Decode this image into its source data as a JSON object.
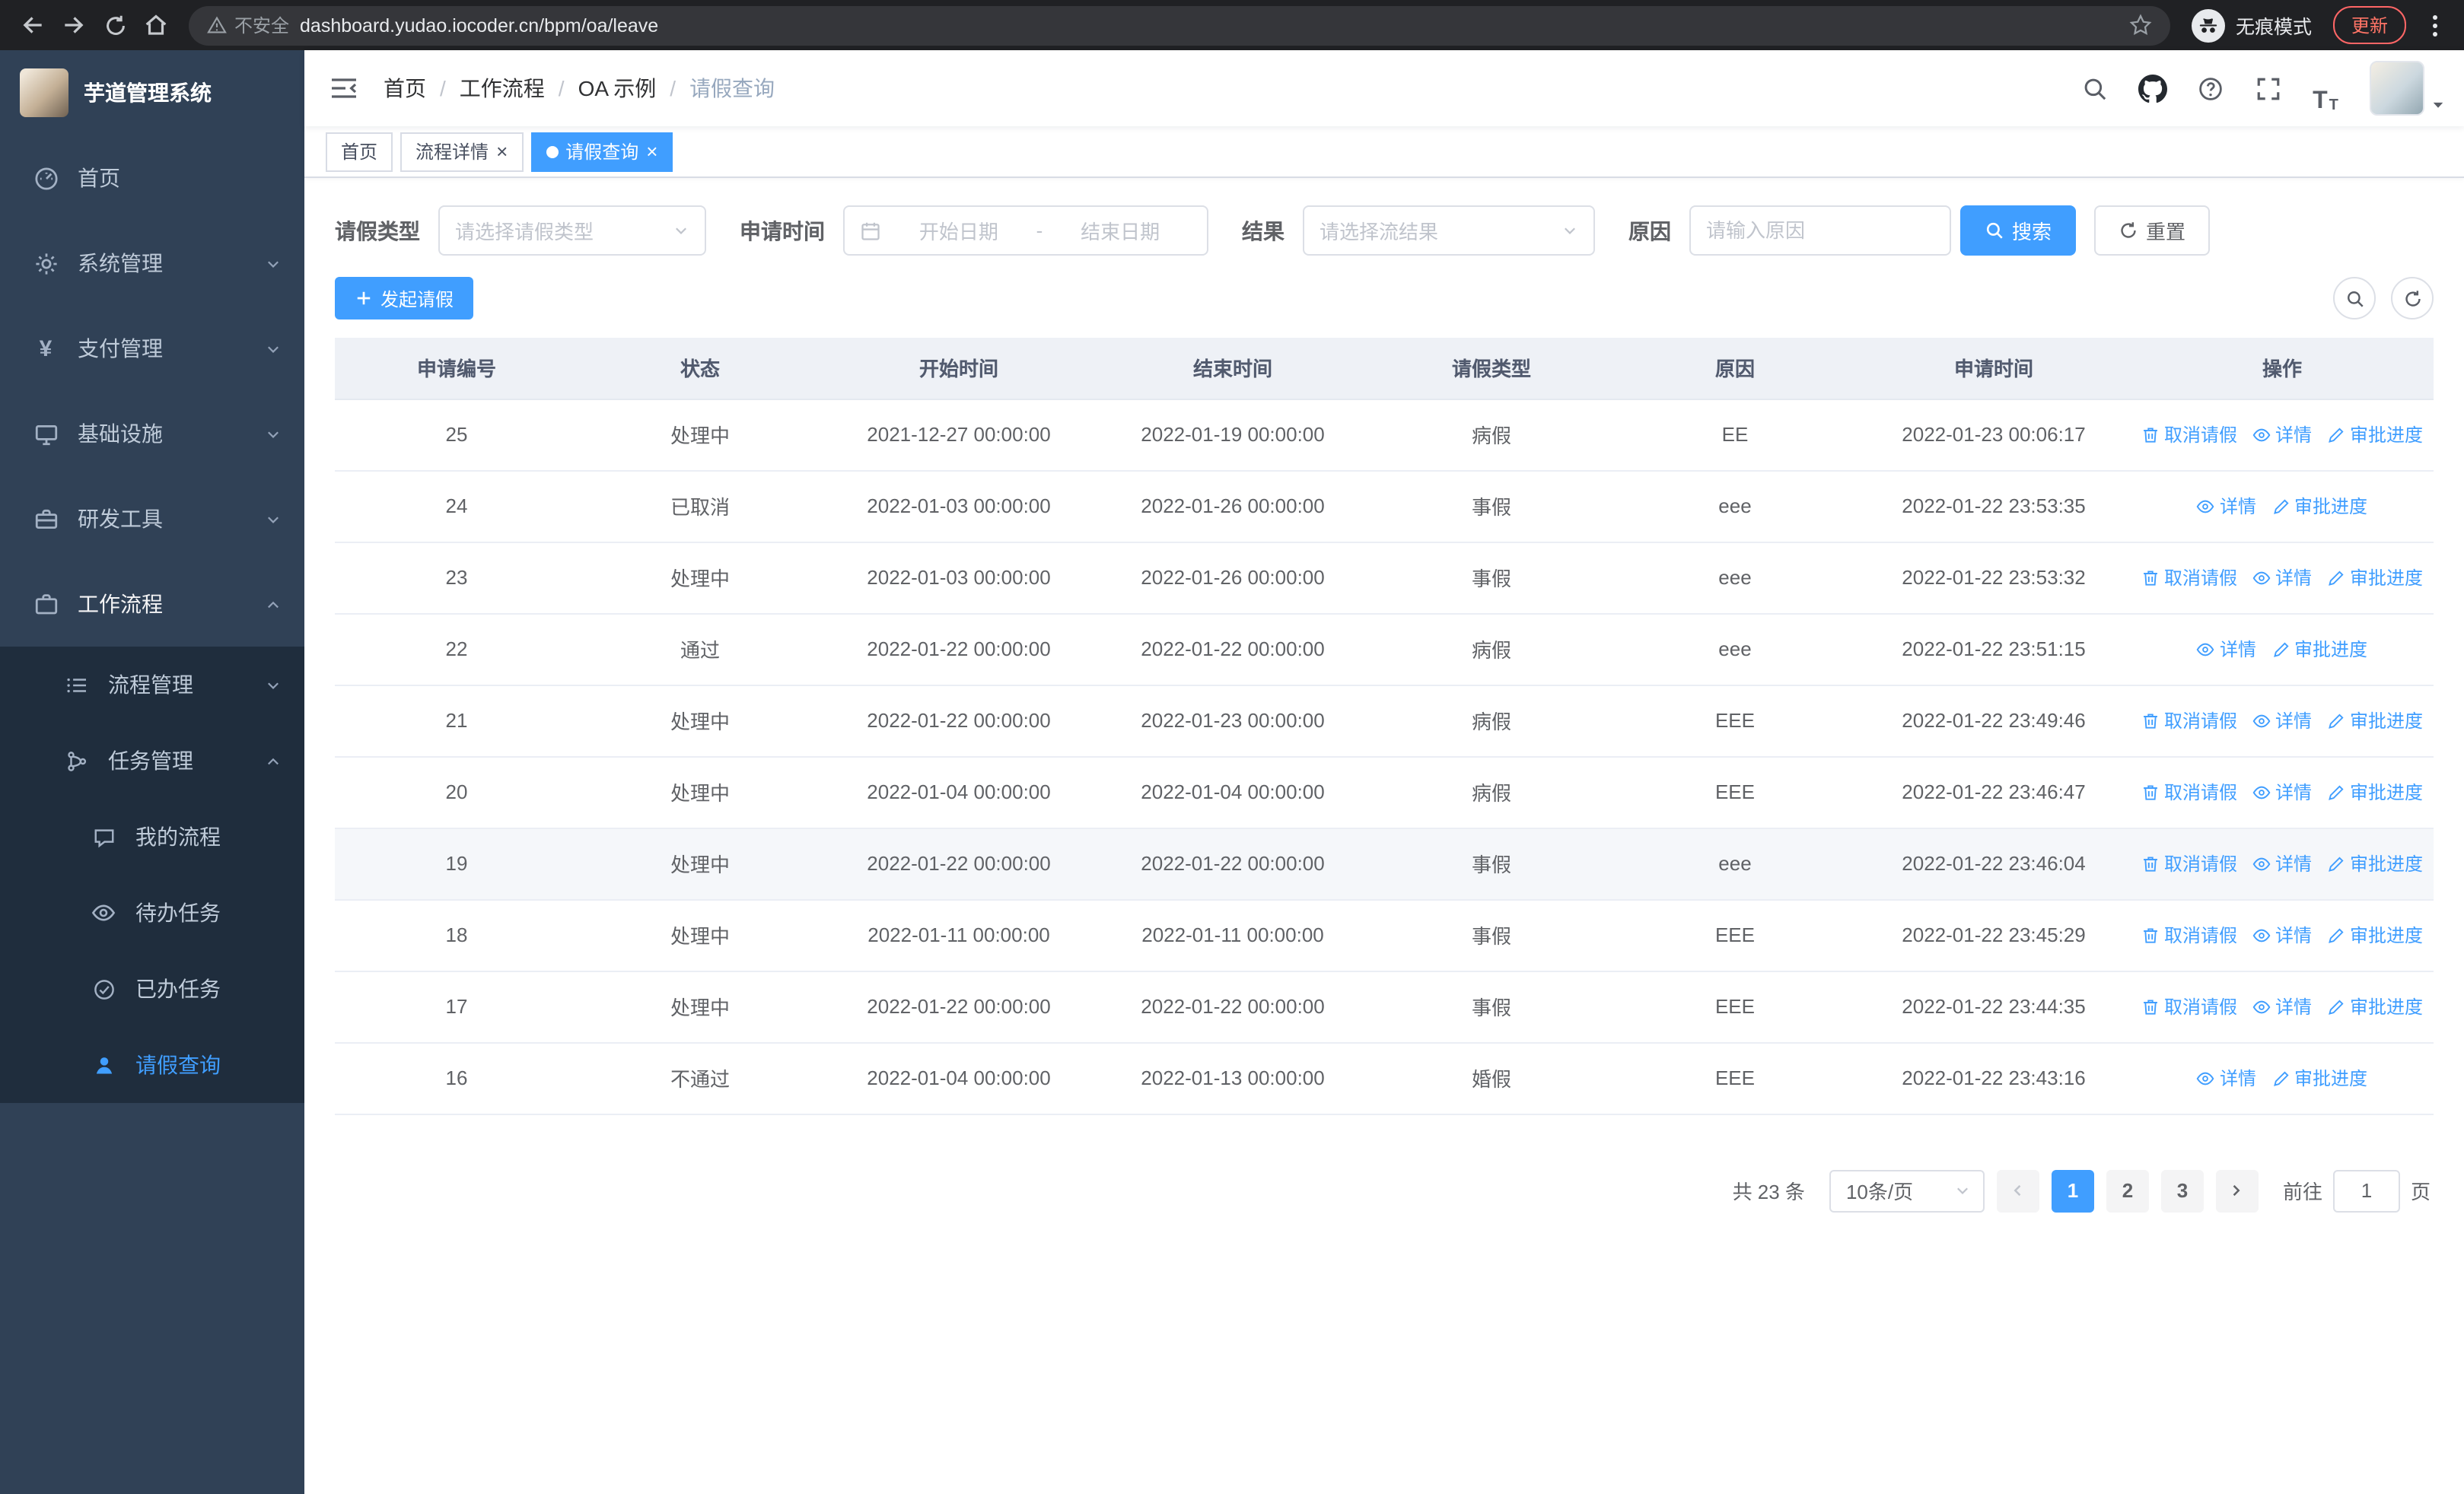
{
  "browser": {
    "security_label": "不安全",
    "url": "dashboard.yudao.iocoder.cn/bpm/oa/leave",
    "incognito_label": "无痕模式",
    "update_label": "更新"
  },
  "sidebar": {
    "app_title": "芋道管理系统",
    "items": [
      {
        "label": "首页"
      },
      {
        "label": "系统管理"
      },
      {
        "label": "支付管理"
      },
      {
        "label": "基础设施"
      },
      {
        "label": "研发工具"
      },
      {
        "label": "工作流程"
      }
    ],
    "workflow_children": [
      {
        "label": "流程管理"
      },
      {
        "label": "任务管理"
      }
    ],
    "task_children": [
      {
        "label": "我的流程"
      },
      {
        "label": "待办任务"
      },
      {
        "label": "已办任务"
      },
      {
        "label": "请假查询"
      }
    ]
  },
  "header": {
    "breadcrumb": [
      "首页",
      "工作流程",
      "OA 示例",
      "请假查询"
    ],
    "breadcrumb_separator": "/"
  },
  "tabs": {
    "close_glyph": "×",
    "items": [
      {
        "label": "首页"
      },
      {
        "label": "流程详情"
      },
      {
        "label": "请假查询"
      }
    ]
  },
  "filters": {
    "leave_type_label": "请假类型",
    "leave_type_placeholder": "请选择请假类型",
    "apply_time_label": "申请时间",
    "start_date_placeholder": "开始日期",
    "range_separator": "-",
    "end_date_placeholder": "结束日期",
    "result_label": "结果",
    "result_placeholder": "请选择流结果",
    "reason_label": "原因",
    "reason_placeholder": "请输入原因",
    "search_label": "搜索",
    "reset_label": "重置"
  },
  "toolbar": {
    "create_label": "发起请假"
  },
  "table": {
    "columns": [
      "申请编号",
      "状态",
      "开始时间",
      "结束时间",
      "请假类型",
      "原因",
      "申请时间",
      "操作"
    ],
    "action_labels": {
      "cancel": "取消请假",
      "detail": "详情",
      "progress": "审批进度"
    },
    "action_icons": {
      "cancel": "delete-icon",
      "detail": "eye-icon",
      "progress": "edit-icon"
    },
    "rows": [
      {
        "apply_no": "25",
        "status": "处理中",
        "start_time": "2021-12-27 00:00:00",
        "end_time": "2022-01-19 00:00:00",
        "leave_type": "病假",
        "reason": "EE",
        "apply_time": "2022-01-23 00:06:17",
        "cancelable": true,
        "highlighted": false
      },
      {
        "apply_no": "24",
        "status": "已取消",
        "start_time": "2022-01-03 00:00:00",
        "end_time": "2022-01-26 00:00:00",
        "leave_type": "事假",
        "reason": "eee",
        "apply_time": "2022-01-22 23:53:35",
        "cancelable": false,
        "highlighted": false
      },
      {
        "apply_no": "23",
        "status": "处理中",
        "start_time": "2022-01-03 00:00:00",
        "end_time": "2022-01-26 00:00:00",
        "leave_type": "事假",
        "reason": "eee",
        "apply_time": "2022-01-22 23:53:32",
        "cancelable": true,
        "highlighted": false
      },
      {
        "apply_no": "22",
        "status": "通过",
        "start_time": "2022-01-22 00:00:00",
        "end_time": "2022-01-22 00:00:00",
        "leave_type": "病假",
        "reason": "eee",
        "apply_time": "2022-01-22 23:51:15",
        "cancelable": false,
        "highlighted": false
      },
      {
        "apply_no": "21",
        "status": "处理中",
        "start_time": "2022-01-22 00:00:00",
        "end_time": "2022-01-23 00:00:00",
        "leave_type": "病假",
        "reason": "EEE",
        "apply_time": "2022-01-22 23:49:46",
        "cancelable": true,
        "highlighted": false
      },
      {
        "apply_no": "20",
        "status": "处理中",
        "start_time": "2022-01-04 00:00:00",
        "end_time": "2022-01-04 00:00:00",
        "leave_type": "病假",
        "reason": "EEE",
        "apply_time": "2022-01-22 23:46:47",
        "cancelable": true,
        "highlighted": false
      },
      {
        "apply_no": "19",
        "status": "处理中",
        "start_time": "2022-01-22 00:00:00",
        "end_time": "2022-01-22 00:00:00",
        "leave_type": "事假",
        "reason": "eee",
        "apply_time": "2022-01-22 23:46:04",
        "cancelable": true,
        "highlighted": true
      },
      {
        "apply_no": "18",
        "status": "处理中",
        "start_time": "2022-01-11 00:00:00",
        "end_time": "2022-01-11 00:00:00",
        "leave_type": "事假",
        "reason": "EEE",
        "apply_time": "2022-01-22 23:45:29",
        "cancelable": true,
        "highlighted": false
      },
      {
        "apply_no": "17",
        "status": "处理中",
        "start_time": "2022-01-22 00:00:00",
        "end_time": "2022-01-22 00:00:00",
        "leave_type": "事假",
        "reason": "EEE",
        "apply_time": "2022-01-22 23:44:35",
        "cancelable": true,
        "highlighted": false
      },
      {
        "apply_no": "16",
        "status": "不通过",
        "start_time": "2022-01-04 00:00:00",
        "end_time": "2022-01-13 00:00:00",
        "leave_type": "婚假",
        "reason": "EEE",
        "apply_time": "2022-01-22 23:43:16",
        "cancelable": false,
        "highlighted": false
      }
    ]
  },
  "pagination": {
    "total_label": "共 23 条",
    "page_size_label": "10条/页",
    "pages": [
      "1",
      "2",
      "3"
    ],
    "active_page": "1",
    "goto_label": "前往",
    "goto_value": "1",
    "unit_label": "页"
  },
  "icons": {
    "size_icon_large": "T",
    "size_icon_small": "T"
  },
  "colors": {
    "primary": "#409eff",
    "sidebar_bg": "#304156",
    "submenu_bg": "#1f2d3d",
    "chrome_bg": "#202124",
    "update_accent": "#ff7466"
  }
}
